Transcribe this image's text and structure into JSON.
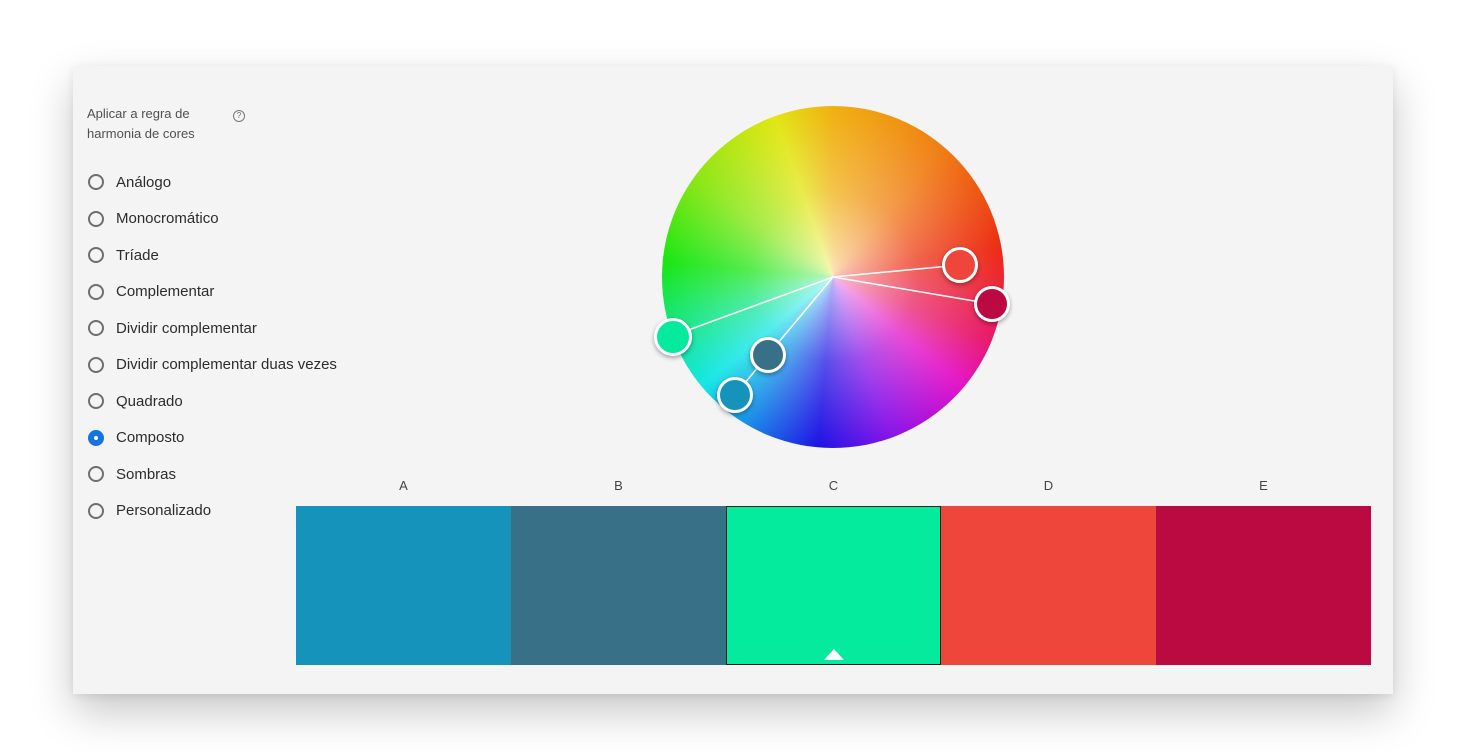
{
  "rules": {
    "title": "Aplicar a regra de harmonia de cores",
    "help_icon": "help-circle-icon",
    "help_glyph": "?",
    "options": [
      {
        "label": "Análogo",
        "selected": false
      },
      {
        "label": "Monocromático",
        "selected": false
      },
      {
        "label": "Tríade",
        "selected": false
      },
      {
        "label": "Complementar",
        "selected": false
      },
      {
        "label": "Dividir complementar",
        "selected": false
      },
      {
        "label": "Dividir complementar duas vezes",
        "selected": false
      },
      {
        "label": "Quadrado",
        "selected": false
      },
      {
        "label": "Composto",
        "selected": true
      },
      {
        "label": "Sombras",
        "selected": false
      },
      {
        "label": "Personalizado",
        "selected": false
      }
    ]
  },
  "swatches": [
    {
      "label": "A",
      "color": "#1693bb"
    },
    {
      "label": "B",
      "color": "#387187"
    },
    {
      "label": "C",
      "color": "#04eb9d"
    },
    {
      "label": "D",
      "color": "#ef463b"
    },
    {
      "label": "E",
      "color": "#bb0a41"
    }
  ],
  "active_swatch": "C",
  "colors": {
    "accent": "#1473e6",
    "panel_bg": "#f4f4f4"
  }
}
